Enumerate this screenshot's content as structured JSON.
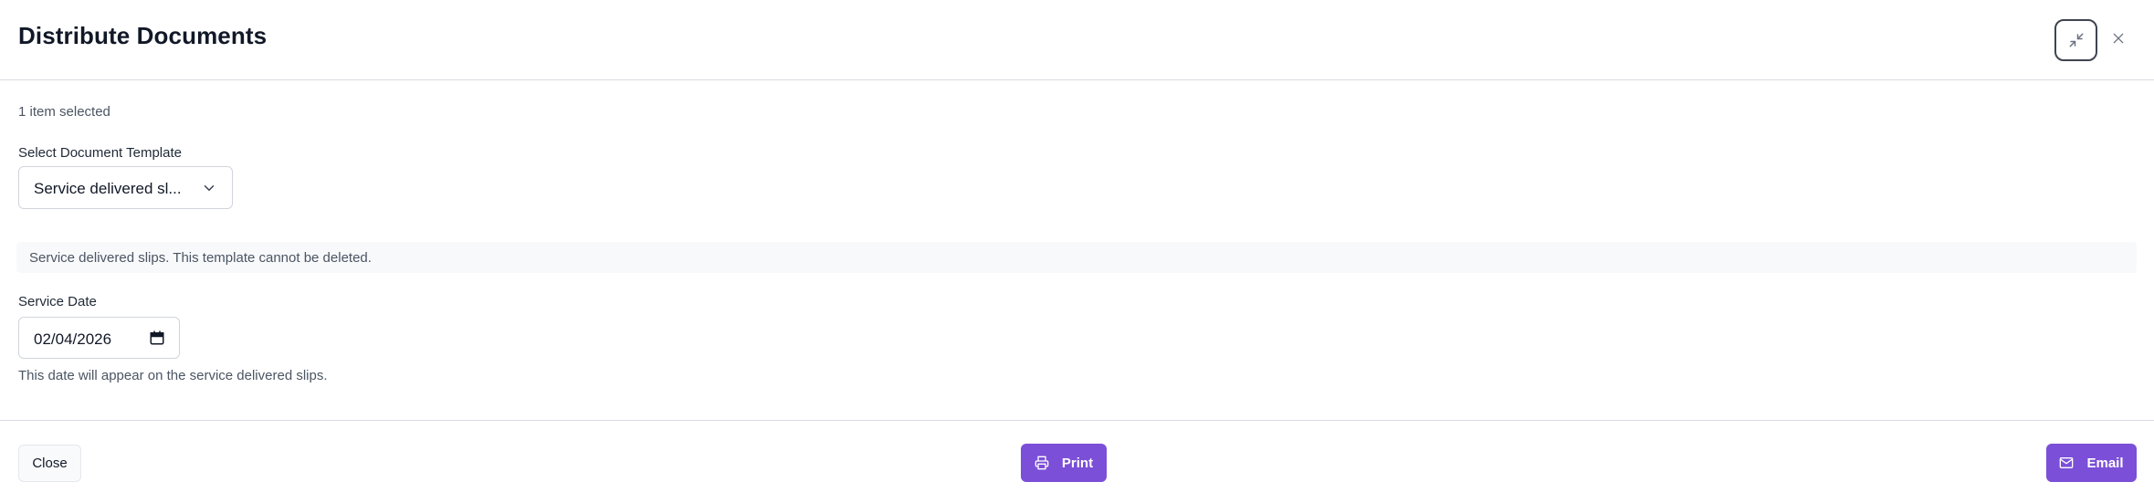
{
  "dialog": {
    "title": "Distribute Documents"
  },
  "selection": {
    "count_text": "1 item selected"
  },
  "template": {
    "label": "Select Document Template",
    "selected_value": "Service delivered sl...",
    "note": "Service delivered slips. This template cannot be deleted."
  },
  "service_date": {
    "label": "Service Date",
    "value": "02/04/2026",
    "help": "This date will appear on the service delivered slips."
  },
  "footer": {
    "close_label": "Close",
    "print_label": "Print",
    "email_label": "Email"
  },
  "icons": {
    "minimize": "minimize-icon",
    "close": "close-icon",
    "chevron": "chevron-down-icon",
    "calendar": "calendar-icon",
    "print": "printer-icon",
    "email": "mail-icon"
  },
  "colors": {
    "primary": "#7b4fd8",
    "border": "#d1d5db",
    "note_bg": "#f8f9fb"
  }
}
